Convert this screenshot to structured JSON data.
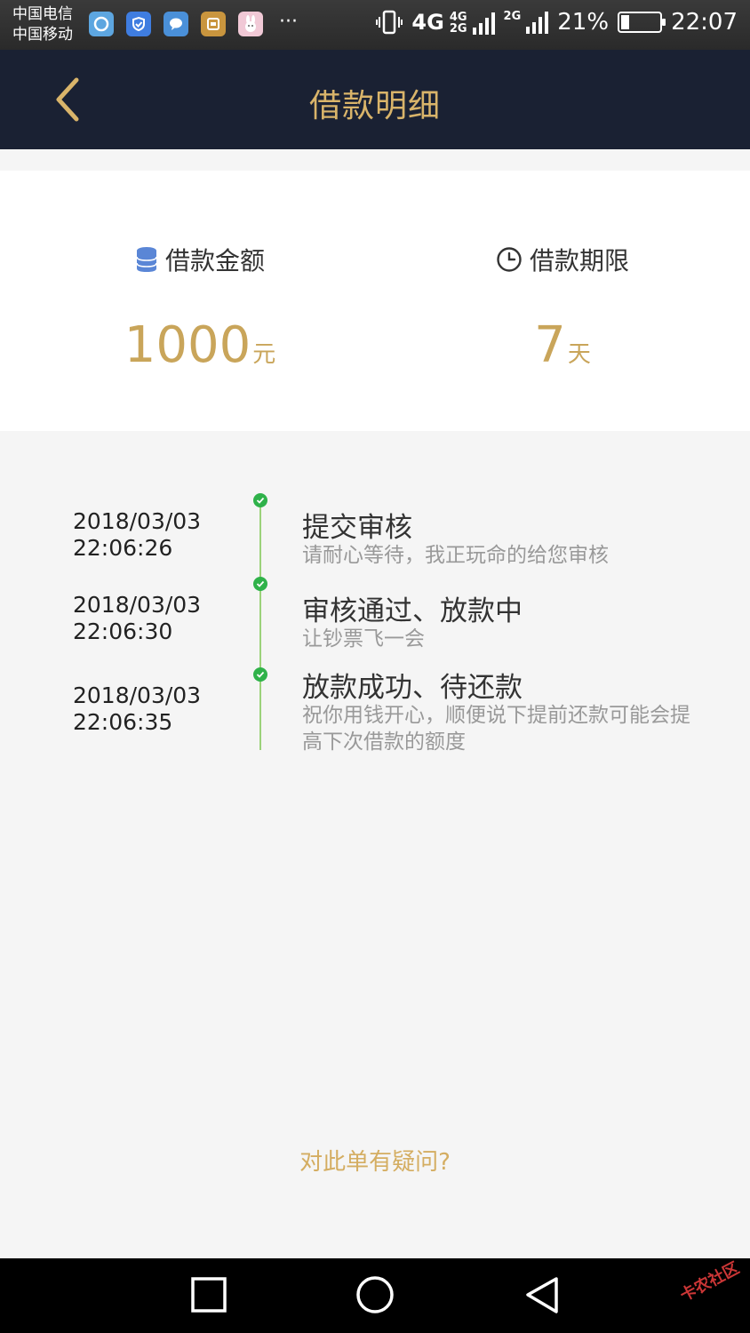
{
  "status_bar": {
    "carrier_1": "中国电信",
    "carrier_2": "中国移动",
    "more": "···",
    "net_4g": "4G",
    "net_4g_small": "4G",
    "net_2g_small": "2G",
    "net_2g": "2G",
    "battery_level": "21%",
    "battery_fraction": 0.21,
    "time": "22:07"
  },
  "header": {
    "title": "借款明细"
  },
  "summary": {
    "amount_label": "借款金额",
    "amount_value": "1000",
    "amount_unit": "元",
    "term_label": "借款期限",
    "term_value": "7",
    "term_unit": "天"
  },
  "timeline": {
    "items": [
      {
        "date": "2018/03/03",
        "time": "22:06:26",
        "title": "提交审核",
        "desc": "请耐心等待，我正玩命的给您审核"
      },
      {
        "date": "2018/03/03",
        "time": "22:06:30",
        "title": "审核通过、放款中",
        "desc": "让钞票飞一会"
      },
      {
        "date": "2018/03/03",
        "time": "22:06:35",
        "title": "放款成功、待还款",
        "desc": "祝你用钱开心，顺便说下提前还款可能会提高下次借款的额度"
      }
    ]
  },
  "question_link": "对此单有疑问?",
  "watermark": "卡农社区",
  "colors": {
    "header_bg": "#1a2133",
    "gold": "#c9a55a",
    "success_green": "#2fb24a",
    "timeline_line": "#9bd27a"
  }
}
